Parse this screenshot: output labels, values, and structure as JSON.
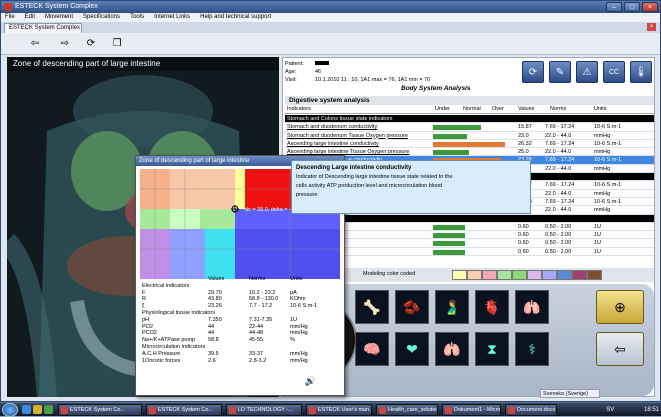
{
  "window": {
    "title": "ESTECK System Complex"
  },
  "menu": [
    "File",
    "Edit",
    "Movement",
    "Specifications",
    "Tools",
    "Internet Links",
    "Help and technical support"
  ],
  "tab": {
    "label": "ESTECK System Complex",
    "close": "×"
  },
  "toolbar": {
    "back_icon": "arrow-left-icon",
    "forward_icon": "arrow-right-icon",
    "refresh_icon": "refresh-icon",
    "copy_icon": "copy-icon"
  },
  "zone_title": "Zone of descending part of large intestine",
  "patient": {
    "patient_label": "Patient:",
    "patient_value": "",
    "age_label": "Age:",
    "age_value": "46",
    "visit_label": "Visit:",
    "visit_value": "10.1.2010  11 : 10, 1A1 max = 76, 1A1 min = 70"
  },
  "body_system_analysis": "Body System Analysis",
  "right_icons": [
    "refresh-icon",
    "edit-icon",
    "warning-icon",
    "cc-icon",
    "thermometer-icon"
  ],
  "digestive": {
    "title": "Digestive system analysis",
    "headers": {
      "indicators": "Indicators",
      "under": "Under",
      "normal": "Normal",
      "over": "Over",
      "values": "Values",
      "norms": "Norms",
      "units": "Units"
    },
    "rows": [
      {
        "name": "Stomach and Colons tissue state indicators",
        "group": true,
        "value": "",
        "norm": "",
        "unit": "",
        "bar": 0,
        "color": ""
      },
      {
        "name": "Stomach and duodenum conductivity",
        "value": "15.87",
        "norm": "7.69 - 17.24",
        "unit": "10-6 S.m-1",
        "bar": 0.6,
        "color": "#3c9a3c"
      },
      {
        "name": "Stomach and duodenum Tissue Oxygen pressure",
        "value": "23.0",
        "norm": "22.0 - 44.0",
        "unit": "mmHg",
        "bar": 0.42,
        "color": "#3c9a3c"
      },
      {
        "name": "Ascending large intestine conductivity",
        "value": "26.32",
        "norm": "7.69 - 17.24",
        "unit": "10-6 S.m-1",
        "bar": 0.9,
        "color": "#e07a30"
      },
      {
        "name": "Ascending large intestine Tissue Oxygen pressure",
        "value": "25.0",
        "norm": "22.0 - 44.0",
        "unit": "mmHg",
        "bar": 0.45,
        "color": "#3c9a3c"
      },
      {
        "name": "Descending large intestine conductivity",
        "value": "23.26",
        "norm": "7.69 - 17.24",
        "unit": "10-6 S.m-1",
        "bar": 0.85,
        "color": "#e07a30",
        "selected": true
      },
      {
        "name": "",
        "value": "44.0",
        "norm": "22.0 - 44.0",
        "unit": "mmHg",
        "bar": 0.55,
        "color": "#3c9a3c"
      },
      {
        "name": "",
        "group": true,
        "value": "",
        "norm": "",
        "unit": "",
        "bar": 0,
        "color": ""
      },
      {
        "name": "",
        "value": "15.87",
        "norm": "7.69 - 17.24",
        "unit": "10-6 S.m-1",
        "bar": 0.6,
        "color": "#3c9a3c"
      },
      {
        "name": "",
        "value": "23.0",
        "norm": "22.0 - 44.0",
        "unit": "mmHg",
        "bar": 0.42,
        "color": "#3c9a3c"
      },
      {
        "name": "",
        "value": "20.83",
        "norm": "7.69 - 17.24",
        "unit": "10-6 S.m-1",
        "bar": 0.8,
        "color": "#e07a30"
      },
      {
        "name": "",
        "value": "23.0",
        "norm": "22.0 - 44.0",
        "unit": "mmHg",
        "bar": 0.42,
        "color": "#3c9a3c"
      },
      {
        "name": "",
        "group": true,
        "value": "",
        "norm": "",
        "unit": "",
        "bar": 0,
        "color": ""
      },
      {
        "name": "tonus",
        "value": "0.60",
        "norm": "0.50 - 2.00",
        "unit": "1U",
        "bar": 0.4,
        "color": "#3c9a3c"
      },
      {
        "name": "ectum)",
        "value": "0.60",
        "norm": "0.50 - 2.00",
        "unit": "1U",
        "bar": 0.4,
        "color": "#3c9a3c"
      },
      {
        "name": "ancreatic secretions",
        "value": "0.60",
        "norm": "0.50 - 2.00",
        "unit": "1U",
        "bar": 0.4,
        "color": "#3c9a3c"
      },
      {
        "name": "",
        "value": "0.60",
        "norm": "0.50 - 2.00",
        "unit": "1U",
        "bar": 0.4,
        "color": "#3c9a3c"
      }
    ]
  },
  "color_coded": {
    "label": "Modeling color coded",
    "swatches": [
      "#ffffb0",
      "#f6d2b0",
      "#f5a5b5",
      "#a8e6a0",
      "#8fd87a",
      "#d8b8f2",
      "#a8a8ff",
      "#5a8ad8",
      "#a04070",
      "#7a5030"
    ]
  },
  "organs": [
    "spine-organ-icon",
    "kidney-organ-icon",
    "stomach-organ-icon",
    "liver-organ-icon",
    "lungs-organ-icon",
    "brain-organ-icon",
    "heart-organ-icon",
    "lungs-organ-icon",
    "hourglass-icon",
    "pancreas-organ-icon"
  ],
  "popup": {
    "title": "Zone of descending part of large intestine",
    "cursor_label": "dc = 39.0, delta = -0.4",
    "measurements": {
      "headers": {
        "values": "Values",
        "norms": "Norms",
        "units": "Units"
      },
      "rows": [
        {
          "name": "Electrical indicators",
          "value": "",
          "norm": "",
          "unit": ""
        },
        {
          "name": "F",
          "value": "29.70",
          "norm": "10.2 - 23.2",
          "unit": "μA"
        },
        {
          "name": "R",
          "value": "43.80",
          "norm": "58.8 - 130.0",
          "unit": "KOhm"
        },
        {
          "name": "ξ",
          "value": "23.26",
          "norm": "7.7 - 17.2",
          "unit": "10-6 S.m-1"
        },
        {
          "name": "Physiological  tissue indicators",
          "value": "",
          "norm": "",
          "unit": ""
        },
        {
          "name": "pH",
          "value": "7.350",
          "norm": "7.31-7.35",
          "unit": "1U"
        },
        {
          "name": "PO2",
          "value": "44",
          "norm": "22-44",
          "unit": "mm/Hg"
        },
        {
          "name": "PCO2",
          "value": "44",
          "norm": "44-48",
          "unit": "mm/Hg"
        },
        {
          "name": "Na+/K+ATPase pump",
          "value": "58.8",
          "norm": "45-55",
          "unit": "%"
        },
        {
          "name": "Microcirculation indicators",
          "value": "",
          "norm": "",
          "unit": ""
        },
        {
          "name": "A.C.H Pressure",
          "value": "39.5",
          "norm": "33-37",
          "unit": "mm/Hg"
        },
        {
          "name": "1Oncotic forces",
          "value": "2.6",
          "norm": "2.8-3.2",
          "unit": "mm/Hg"
        }
      ]
    }
  },
  "tooltip": {
    "title": "Descending Large intestine conductivity",
    "line1": "Indicator of Descending large intestine tissue state related to the",
    "line2": "cells activity ATP production level and microcirculation blood",
    "line3": "pressure"
  },
  "language": "Svenska (Sverige)",
  "taskbar": {
    "tasks": [
      "ESTECK System Co...",
      "ESTECK System Co...",
      "LD TECHNOLOGY -...",
      "ESTECK User's man...",
      "Health_care_solutio...",
      "Dokument1 - Micro...",
      "Document.docx - Mi..."
    ],
    "tray_lang": "SV",
    "clock": "18:51"
  }
}
